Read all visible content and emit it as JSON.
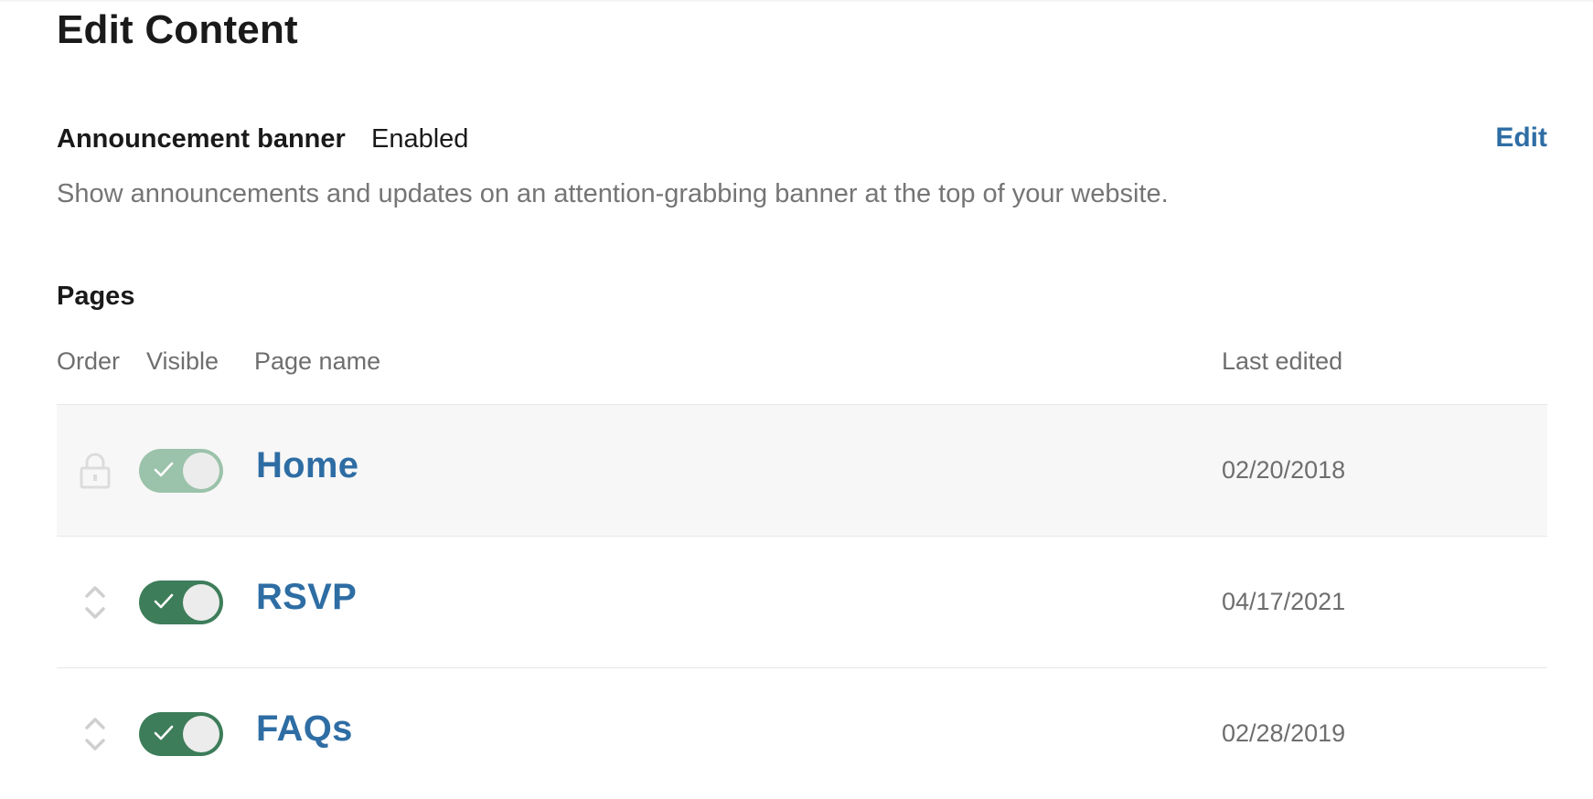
{
  "header": {
    "title": "Edit Content"
  },
  "announcement": {
    "label": "Announcement banner",
    "status": "Enabled",
    "edit_label": "Edit",
    "description": "Show announcements and updates on an attention-grabbing banner at the top of your website."
  },
  "pages_section": {
    "title": "Pages",
    "columns": {
      "order": "Order",
      "visible": "Visible",
      "page_name": "Page name",
      "last_edited": "Last edited"
    },
    "rows": [
      {
        "name": "Home",
        "last_edited": "02/20/2018",
        "visible": true,
        "locked": true,
        "order_icon": "lock-icon"
      },
      {
        "name": "RSVP",
        "last_edited": "04/17/2021",
        "visible": true,
        "locked": false,
        "order_icon": "reorder-icon"
      },
      {
        "name": "FAQs",
        "last_edited": "02/28/2019",
        "visible": true,
        "locked": false,
        "order_icon": "reorder-icon"
      }
    ]
  },
  "colors": {
    "link": "#2e6da4",
    "toggle_on": "#3d7d5a",
    "toggle_disabled": "#9bc2aa",
    "muted_text": "#757575",
    "locked_row_bg": "#f7f7f7"
  }
}
